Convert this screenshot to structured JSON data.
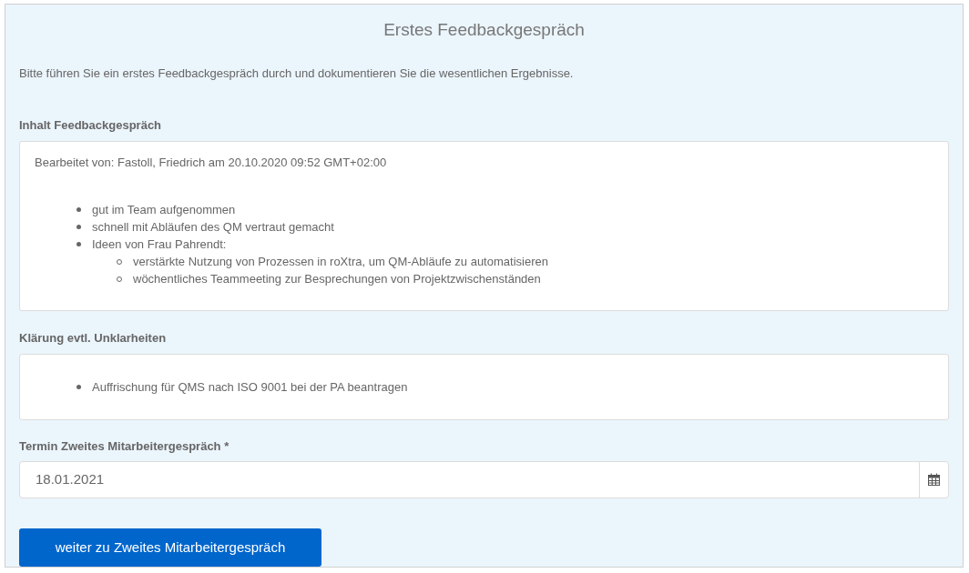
{
  "title": "Erstes Feedbackgespräch",
  "intro": "Bitte führen Sie ein erstes Feedbackgespräch durch und dokumentieren Sie die wesentlichen Ergebnisse.",
  "sections": [
    {
      "label": "Inhalt Feedbackgespräch",
      "edited_by": "Bearbeitet von: Fastoll, Friedrich am 20.10.2020 09:52 GMT+02:00",
      "items": [
        {
          "text": "gut im Team aufgenommen"
        },
        {
          "text": "schnell mit Abläufen des QM vertraut gemacht"
        },
        {
          "text": "Ideen von Frau Pahrendt:",
          "children": [
            {
              "text": "verstärkte Nutzung von Prozessen in roXtra, um QM-Abläufe zu automatisieren"
            },
            {
              "text": "wöchentliches Teammeeting zur Besprechungen von Projektzwischenständen"
            }
          ]
        }
      ]
    },
    {
      "label": "Klärung evtl. Unklarheiten",
      "items": [
        {
          "text": "Auffrischung für QMS nach ISO 9001 bei der PA beantragen"
        }
      ]
    }
  ],
  "date_field": {
    "label": "Termin Zweites Mitarbeitergespräch *",
    "value": "18.01.2021"
  },
  "button": "weiter zu Zweites Mitarbeitergespräch"
}
